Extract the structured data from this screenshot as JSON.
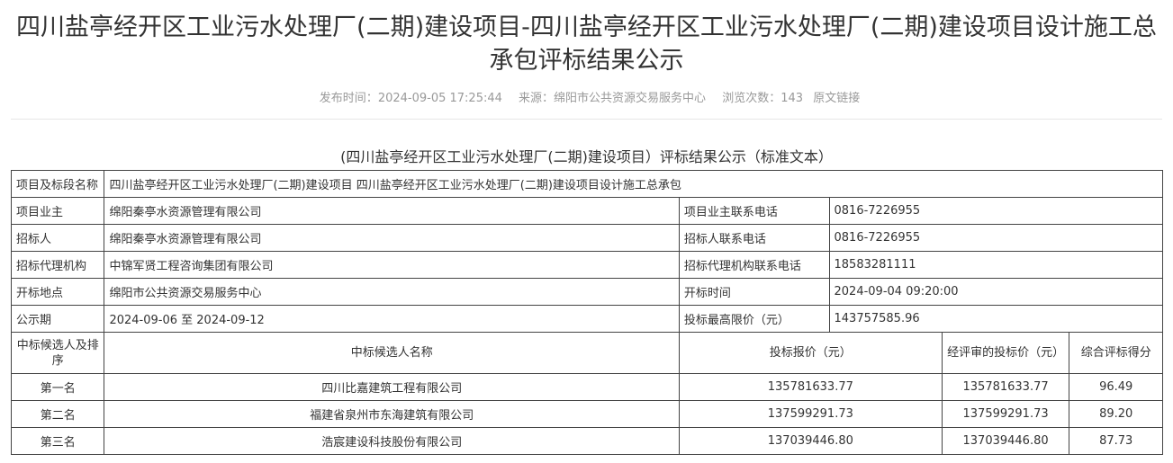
{
  "page": {
    "title": "四川盐亭经开区工业污水处理厂(二期)建设项目-四川盐亭经开区工业污水处理厂(二期)建设项目设计施工总承包评标结果公示",
    "meta": {
      "publish_label": "发布时间：",
      "publish_time": "2024-09-05 17:25:44",
      "source_label": "来源：",
      "source": "绵阳市公共资源交易服务中心",
      "views_label": "浏览次数：",
      "views": "143",
      "original_link": "原文链接"
    },
    "subtitle": "(四川盐亭经开区工业污水处理厂(二期)建设项目）评标结果公示（标准文本）"
  },
  "table": {
    "project_name_label": "项目及标段名称",
    "project_name": "四川盐亭经开区工业污水处理厂(二期)建设项目 四川盐亭经开区工业污水处理厂(二期)建设项目设计施工总承包",
    "info_rows": [
      {
        "label": "项目业主",
        "value": "绵阳秦亭水资源管理有限公司",
        "label2": "项目业主联系电话",
        "value2": "0816-7226955"
      },
      {
        "label": "招标人",
        "value": "绵阳秦亭水资源管理有限公司",
        "label2": "招标人联系电话",
        "value2": "0816-7226955"
      },
      {
        "label": "招标代理机构",
        "value": "中锦军贤工程咨询集团有限公司",
        "label2": "招标代理机构联系电话",
        "value2": "18583281111"
      },
      {
        "label": "开标地点",
        "value": "绵阳市公共资源交易服务中心",
        "label2": "开标时间",
        "value2": "2024-09-04 09:20:00"
      },
      {
        "label": "公示期",
        "value": "2024-09-06 至 2024-09-12",
        "label2": "投标最高限价（元）",
        "value2": "143757585.96"
      }
    ],
    "candidate_headers": {
      "rank": "中标候选人及排序",
      "name": "中标候选人名称",
      "bid": "投标报价（元）",
      "reviewed": "经评审的投标价（元）",
      "score": "综合评标得分"
    },
    "candidates": [
      {
        "rank": "第一名",
        "name": "四川比嘉建筑工程有限公司",
        "bid": "135781633.77",
        "reviewed": "135781633.77",
        "score": "96.49"
      },
      {
        "rank": "第二名",
        "name": "福建省泉州市东海建筑有限公司",
        "bid": "137599291.73",
        "reviewed": "137599291.73",
        "score": "89.20"
      },
      {
        "rank": "第三名",
        "name": "浩宸建设科技股份有限公司",
        "bid": "137039446.80",
        "reviewed": "137039446.80",
        "score": "87.73"
      }
    ]
  }
}
